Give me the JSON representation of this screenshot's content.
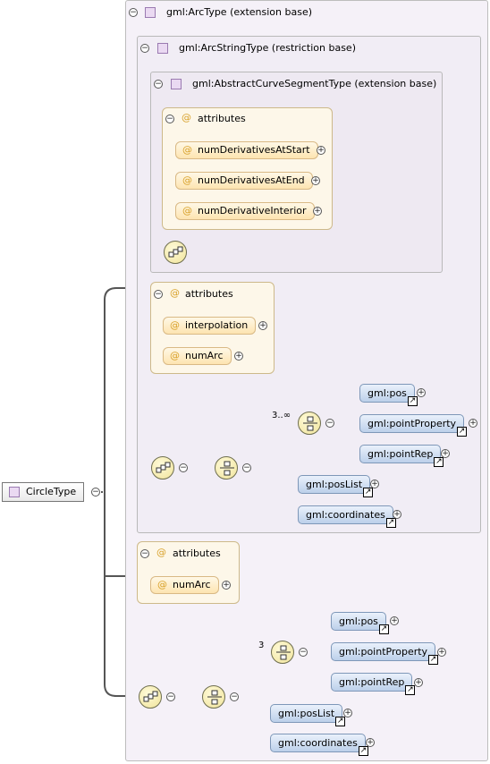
{
  "root": {
    "label": "CircleType"
  },
  "arc_type": {
    "label": "gml:ArcType (extension base)"
  },
  "arc_string_type": {
    "label": "gml:ArcStringType (restriction base)"
  },
  "abstract_curve": {
    "label": "gml:AbstractCurveSegmentType (extension base)"
  },
  "attributes_label": "attributes",
  "abstract_curve_attributes": [
    "numDerivativesAtStart",
    "numDerivativesAtEnd",
    "numDerivativeInterior"
  ],
  "arc_string_attributes": [
    "interpolation",
    "numArc"
  ],
  "circle_attributes": [
    "numArc"
  ],
  "arc_string_choice": {
    "cardinality": "3..∞",
    "choice_elements": [
      "gml:pos",
      "gml:pointProperty",
      "gml:pointRep"
    ],
    "other_elements": [
      "gml:posList",
      "gml:coordinates"
    ]
  },
  "circle_choice": {
    "cardinality": "3",
    "choice_elements": [
      "gml:pos",
      "gml:pointProperty",
      "gml:pointRep"
    ],
    "other_elements": [
      "gml:posList",
      "gml:coordinates"
    ]
  },
  "colors": {
    "attribute": "#fde4b0",
    "element": "#bcd0ea",
    "type_square": "#ead9f2",
    "frame": "#f5f1f8"
  }
}
